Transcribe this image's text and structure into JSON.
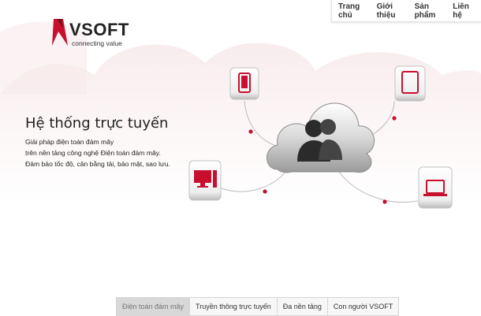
{
  "logo": {
    "name": "VSOFT",
    "tagline": "connecting value"
  },
  "nav": [
    "Trang chủ",
    "Giới thiệu",
    "Sản phẩm",
    "Liên hệ"
  ],
  "hero": {
    "title": "Hệ thống trực tuyến",
    "lines": [
      "Giải pháp điện toán đám mây",
      "trên nền tảng công nghệ Điện toán đám mây.",
      "Đảm bảo tốc độ, cân bằng tải, bảo mật, sao lưu."
    ]
  },
  "tabs": [
    "Điện toán đám mây",
    "Truyền thông trực tuyến",
    "Đa nền tảng",
    "Con người VSOFT"
  ],
  "active_tab": 0,
  "colors": {
    "accent": "#c8102e",
    "text": "#222222"
  },
  "icons": [
    "mobile-phone-icon",
    "tablet-icon",
    "desktop-computer-icon",
    "laptop-icon",
    "cloud-users-icon"
  ]
}
